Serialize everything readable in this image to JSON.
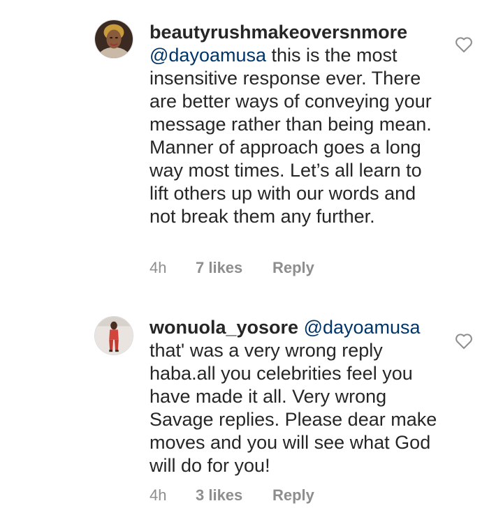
{
  "comments": [
    {
      "username": "beautyrushmakeoversnmore",
      "mention": "@dayoamusa",
      "text": " this is the most insensitive response ever. There are better ways of conveying your message rather than being mean. Manner of approach goes a long way most times. Let’s all learn to lift others up with our words and not break them any further.",
      "time": "4h",
      "likes": "7 likes",
      "reply_label": "Reply",
      "like_icon": "heart-outline-icon"
    },
    {
      "username": "wonuola_yosore",
      "mention": "@dayoamusa",
      "text": " that' was a very wrong reply haba.all you celebrities feel you have made it all. Very wrong Savage replies. Please dear make moves and you will see what God will do for you!",
      "time": "4h",
      "likes": "3 likes",
      "reply_label": "Reply",
      "like_icon": "heart-outline-icon"
    }
  ],
  "colors": {
    "text": "#262626",
    "mention": "#003569",
    "meta": "#8e8e8e"
  }
}
